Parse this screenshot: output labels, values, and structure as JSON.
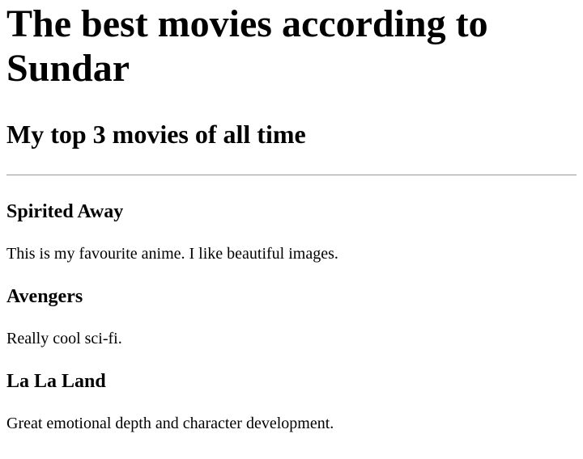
{
  "page": {
    "title": "The best movies according to Sundar",
    "subtitle": "My top 3 movies of all time"
  },
  "movies": [
    {
      "title": "Spirited Away",
      "description": "This is my favourite anime. I like beautiful images."
    },
    {
      "title": "Avengers",
      "description": "Really cool sci-fi."
    },
    {
      "title": "La La Land",
      "description": "Great emotional depth and character development."
    }
  ]
}
